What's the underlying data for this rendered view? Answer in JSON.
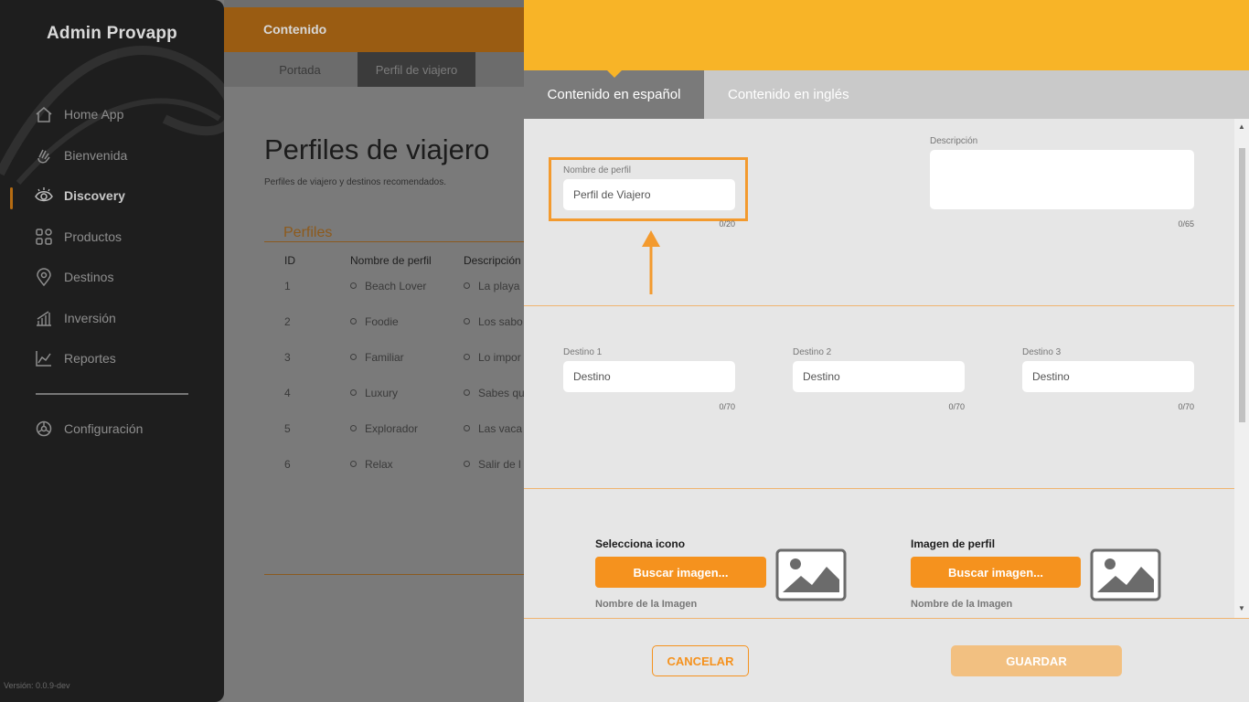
{
  "app": {
    "brand": "Admin Provapp",
    "version": "Versión: 0.0.9-dev"
  },
  "sidebar": {
    "items": [
      {
        "label": "Home App",
        "icon": "home-icon"
      },
      {
        "label": "Bienvenida",
        "icon": "wave-hand-icon"
      },
      {
        "label": "Discovery",
        "icon": "eye-icon",
        "active": true
      },
      {
        "label": "Productos",
        "icon": "grid-icon"
      },
      {
        "label": "Destinos",
        "icon": "location-pin-icon"
      },
      {
        "label": "Inversión",
        "icon": "bar-chart-icon"
      },
      {
        "label": "Reportes",
        "icon": "line-chart-icon"
      }
    ],
    "settings": {
      "label": "Configuración",
      "icon": "gear-icon"
    }
  },
  "background_page": {
    "header": "Contenido",
    "tabs": [
      "Portada",
      "Perfil de viajero"
    ],
    "selected_tab": "Perfil de viajero",
    "title": "Perfiles de viajero",
    "subtitle": "Perfiles de viajero y destinos recomendados.",
    "section": "Perfiles",
    "columns": [
      "ID",
      "Nombre de perfil",
      "Descripción"
    ],
    "rows": [
      {
        "id": "1",
        "name": "Beach Lover",
        "desc": "La playa"
      },
      {
        "id": "2",
        "name": "Foodie",
        "desc": "Los sabo"
      },
      {
        "id": "3",
        "name": "Familiar",
        "desc": "Lo impor"
      },
      {
        "id": "4",
        "name": "Luxury",
        "desc": "Sabes qu"
      },
      {
        "id": "5",
        "name": "Explorador",
        "desc": "Las vaca"
      },
      {
        "id": "6",
        "name": "Relax",
        "desc": "Salir de l"
      }
    ]
  },
  "panel": {
    "tabs": {
      "spanish": "Contenido en español",
      "english": "Contenido en inglés"
    },
    "profile_name": {
      "label": "Nombre de perfil",
      "value": "Perfil de Viajero",
      "counter": "0/20"
    },
    "description": {
      "label": "Descripción",
      "value": "",
      "counter": "0/65"
    },
    "destinations": [
      {
        "label": "Destino 1",
        "placeholder": "Destino",
        "counter": "0/70"
      },
      {
        "label": "Destino 2",
        "placeholder": "Destino",
        "counter": "0/70"
      },
      {
        "label": "Destino 3",
        "placeholder": "Destino",
        "counter": "0/70"
      }
    ],
    "icon_upload": {
      "label": "Selecciona icono",
      "button": "Buscar imagen...",
      "name_label": "Nombre de la Imagen"
    },
    "profile_image_upload": {
      "label": "Imagen de perfil",
      "button": "Buscar imagen...",
      "name_label": "Nombre de la Imagen"
    },
    "footer": {
      "cancel": "CANCELAR",
      "save": "GUARDAR"
    }
  },
  "colors": {
    "accent": "#f8b427",
    "button_orange": "#f5921e",
    "highlight": "#f39a2e",
    "sidebar_bg": "#1e1e1e"
  }
}
